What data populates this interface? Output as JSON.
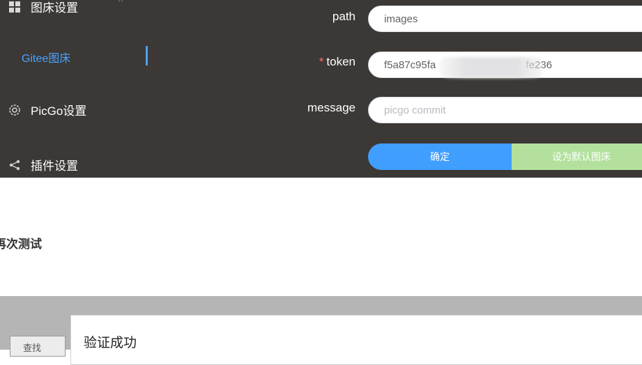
{
  "sidebar": {
    "items": [
      {
        "label": "图床设置",
        "icon": "grid-icon"
      },
      {
        "label": "PicGo设置",
        "icon": "gear-icon"
      },
      {
        "label": "插件设置",
        "icon": "share-icon"
      }
    ],
    "sub_item": "Gitee图床",
    "accent_color": "#409eff"
  },
  "form": {
    "path": {
      "label": "path",
      "value": "images"
    },
    "token": {
      "label": "token",
      "required_mark": "*",
      "value": "f5a87c95fa                               fe236"
    },
    "message": {
      "label": "message",
      "placeholder": "picgo commit"
    },
    "confirm_label": "确定",
    "set_default_label": "设为默认图床"
  },
  "section": {
    "heading": "再次测试"
  },
  "bottom": {
    "find_label": "查找",
    "dialog_title": "验证成功"
  }
}
